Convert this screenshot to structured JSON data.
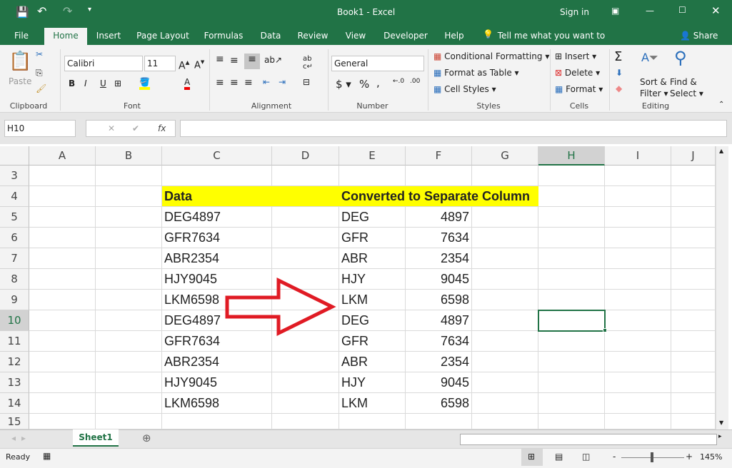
{
  "title": {
    "doc": "Book1 - Excel",
    "sign_in": "Sign in"
  },
  "tabs": [
    "File",
    "Home",
    "Insert",
    "Page Layout",
    "Formulas",
    "Data",
    "Review",
    "View",
    "Developer",
    "Help"
  ],
  "tell_me": "Tell me what you want to do",
  "share": "Share",
  "ribbon": {
    "paste": "Paste",
    "clipboard": "Clipboard",
    "font_name": "Calibri",
    "font_size": "11",
    "font": "Font",
    "alignment": "Alignment",
    "number_format": "General",
    "number": "Number",
    "cond_fmt": "Conditional Formatting",
    "fmt_table": "Format as Table",
    "cell_styles": "Cell Styles",
    "styles": "Styles",
    "insert": "Insert",
    "delete": "Delete",
    "format": "Format",
    "cells": "Cells",
    "sort1": "Sort &",
    "sort2": "Filter",
    "find1": "Find &",
    "find2": "Select",
    "editing": "Editing"
  },
  "formula_bar": {
    "name_box": "H10",
    "value": ""
  },
  "columns": [
    "A",
    "B",
    "C",
    "D",
    "E",
    "F",
    "G",
    "H",
    "I",
    "J"
  ],
  "selected_cell": "H10",
  "rows": [
    {
      "n": "3",
      "c": "",
      "e": "",
      "f": ""
    },
    {
      "n": "4",
      "c": "Data",
      "e": "Converted to Separate Column",
      "f": "",
      "header": true
    },
    {
      "n": "5",
      "c": "DEG4897",
      "e": "DEG",
      "f": "4897"
    },
    {
      "n": "6",
      "c": "GFR7634",
      "e": "GFR",
      "f": "7634"
    },
    {
      "n": "7",
      "c": "ABR2354",
      "e": "ABR",
      "f": "2354"
    },
    {
      "n": "8",
      "c": "HJY9045",
      "e": "HJY",
      "f": "9045"
    },
    {
      "n": "9",
      "c": "LKM6598",
      "e": "LKM",
      "f": "6598"
    },
    {
      "n": "10",
      "c": "DEG4897",
      "e": "DEG",
      "f": "4897"
    },
    {
      "n": "11",
      "c": "GFR7634",
      "e": "GFR",
      "f": "7634"
    },
    {
      "n": "12",
      "c": "ABR2354",
      "e": "ABR",
      "f": "2354"
    },
    {
      "n": "13",
      "c": "HJY9045",
      "e": "HJY",
      "f": "9045"
    },
    {
      "n": "14",
      "c": "LKM6598",
      "e": "LKM",
      "f": "6598"
    },
    {
      "n": "15",
      "c": "",
      "e": "",
      "f": ""
    }
  ],
  "colors": {
    "brand": "#217346",
    "highlight": "#ffff00",
    "arrow": "#e01b24"
  },
  "sheet_tab": "Sheet1",
  "status": {
    "ready": "Ready",
    "zoom": "145%"
  }
}
